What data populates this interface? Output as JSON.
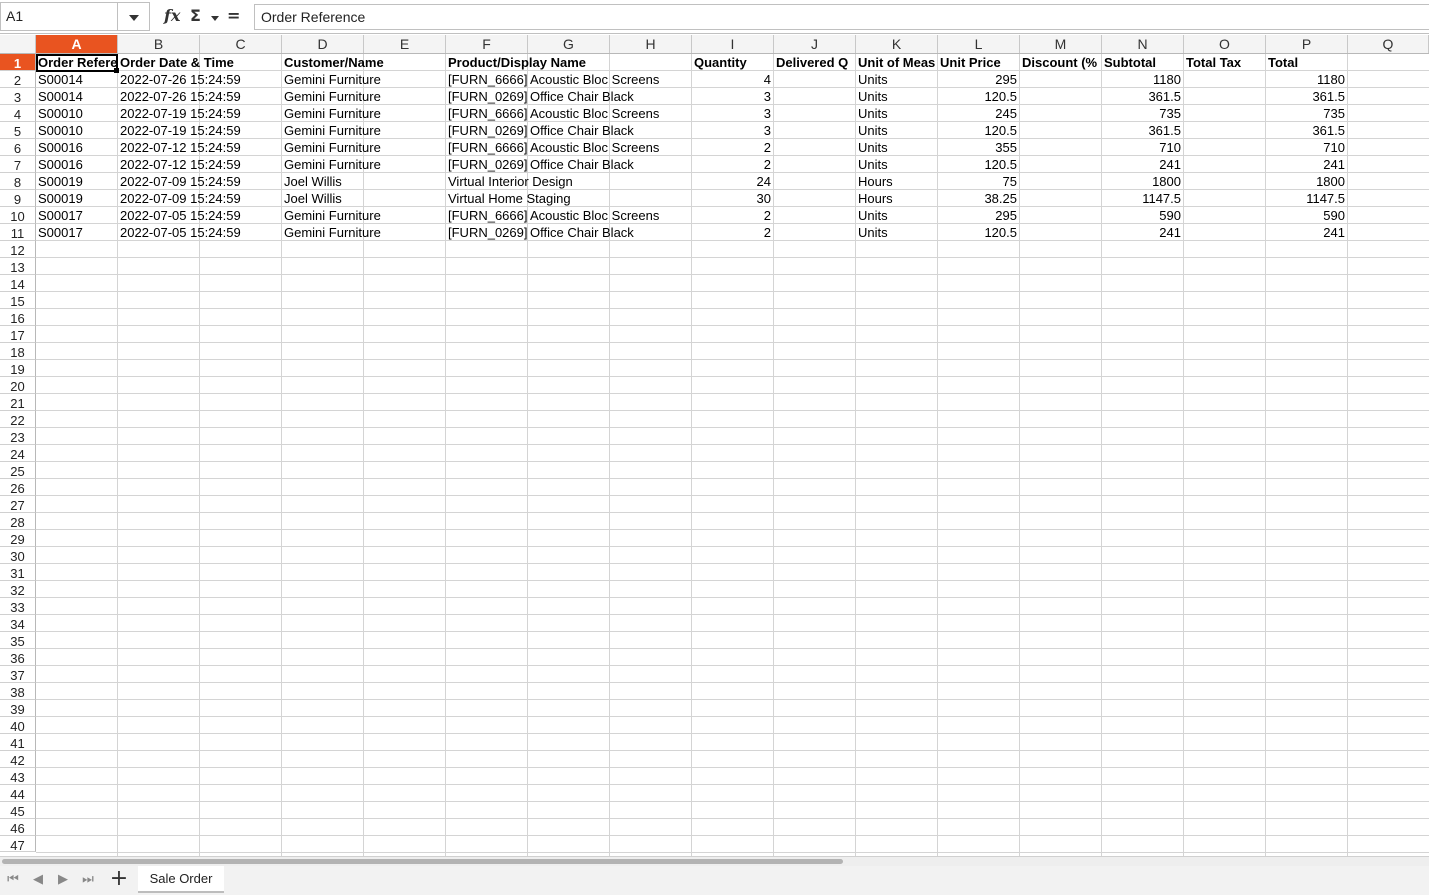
{
  "formula_bar": {
    "cell_reference": "A1",
    "content": "Order Reference"
  },
  "icons": {
    "fx": "fx",
    "sigma": "Σ",
    "equals": "="
  },
  "columns": [
    "A",
    "B",
    "C",
    "D",
    "E",
    "F",
    "G",
    "H",
    "I",
    "J",
    "K",
    "L",
    "M",
    "N",
    "O",
    "P",
    "Q"
  ],
  "row_numbers": [
    "1",
    "2",
    "3",
    "4",
    "5",
    "6",
    "7",
    "8",
    "9",
    "10",
    "11",
    "12",
    "13",
    "14",
    "15",
    "16",
    "17",
    "18",
    "19",
    "20",
    "21",
    "22",
    "23",
    "24",
    "25",
    "26",
    "27",
    "28",
    "29",
    "30",
    "31",
    "32",
    "33",
    "34",
    "35",
    "36",
    "37",
    "38",
    "39",
    "40",
    "41",
    "42",
    "43",
    "44",
    "45",
    "46",
    "47"
  ],
  "header_row": {
    "order_reference": "Order Refere",
    "order_date": "Order Date & Time",
    "customer": "Customer/Name",
    "product": "Product/Display Name",
    "quantity": "Quantity",
    "delivered_qty": "Delivered Q",
    "unit_of_measure": "Unit of Meas",
    "unit_price": "Unit Price",
    "discount": "Discount (%",
    "subtotal": "Subtotal",
    "total_tax": "Total Tax",
    "total": "Total"
  },
  "data_rows": [
    {
      "order_reference": "S00014",
      "order_date": "2022-07-26 15:24:59",
      "customer": "Gemini Furniture",
      "product_code": "[FURN_6666]",
      "product_name": "Acoustic Bloc Screens",
      "quantity": "4",
      "unit_of_measure": "Units",
      "unit_price": "295",
      "subtotal": "1180",
      "total": "1180"
    },
    {
      "order_reference": "S00014",
      "order_date": "2022-07-26 15:24:59",
      "customer": "Gemini Furniture",
      "product_code": "[FURN_0269]",
      "product_name": "Office Chair Black",
      "quantity": "3",
      "unit_of_measure": "Units",
      "unit_price": "120.5",
      "subtotal": "361.5",
      "total": "361.5"
    },
    {
      "order_reference": "S00010",
      "order_date": "2022-07-19 15:24:59",
      "customer": "Gemini Furniture",
      "product_code": "[FURN_6666]",
      "product_name": "Acoustic Bloc Screens",
      "quantity": "3",
      "unit_of_measure": "Units",
      "unit_price": "245",
      "subtotal": "735",
      "total": "735"
    },
    {
      "order_reference": "S00010",
      "order_date": "2022-07-19 15:24:59",
      "customer": "Gemini Furniture",
      "product_code": "[FURN_0269]",
      "product_name": "Office Chair Black",
      "quantity": "3",
      "unit_of_measure": "Units",
      "unit_price": "120.5",
      "subtotal": "361.5",
      "total": "361.5"
    },
    {
      "order_reference": "S00016",
      "order_date": "2022-07-12 15:24:59",
      "customer": "Gemini Furniture",
      "product_code": "[FURN_6666]",
      "product_name": "Acoustic Bloc Screens",
      "quantity": "2",
      "unit_of_measure": "Units",
      "unit_price": "355",
      "subtotal": "710",
      "total": "710"
    },
    {
      "order_reference": "S00016",
      "order_date": "2022-07-12 15:24:59",
      "customer": "Gemini Furniture",
      "product_code": "[FURN_0269]",
      "product_name": "Office Chair Black",
      "quantity": "2",
      "unit_of_measure": "Units",
      "unit_price": "120.5",
      "subtotal": "241",
      "total": "241"
    },
    {
      "order_reference": "S00019",
      "order_date": "2022-07-09 15:24:59",
      "customer": "Joel Willis",
      "product_code": "",
      "product_name": "Virtual Interior Design",
      "quantity": "24",
      "unit_of_measure": "Hours",
      "unit_price": "75",
      "subtotal": "1800",
      "total": "1800"
    },
    {
      "order_reference": "S00019",
      "order_date": "2022-07-09 15:24:59",
      "customer": "Joel Willis",
      "product_code": "",
      "product_name": "Virtual Home Staging",
      "quantity": "30",
      "unit_of_measure": "Hours",
      "unit_price": "38.25",
      "subtotal": "1147.5",
      "total": "1147.5"
    },
    {
      "order_reference": "S00017",
      "order_date": "2022-07-05 15:24:59",
      "customer": "Gemini Furniture",
      "product_code": "[FURN_6666]",
      "product_name": "Acoustic Bloc Screens",
      "quantity": "2",
      "unit_of_measure": "Units",
      "unit_price": "295",
      "subtotal": "590",
      "total": "590"
    },
    {
      "order_reference": "S00017",
      "order_date": "2022-07-05 15:24:59",
      "customer": "Gemini Furniture",
      "product_code": "[FURN_0269]",
      "product_name": "Office Chair Black",
      "quantity": "2",
      "unit_of_measure": "Units",
      "unit_price": "120.5",
      "subtotal": "241",
      "total": "241"
    }
  ],
  "sheet_tabs": [
    {
      "label": "Sale Order"
    }
  ],
  "colors": {
    "accent": "#e95420"
  }
}
